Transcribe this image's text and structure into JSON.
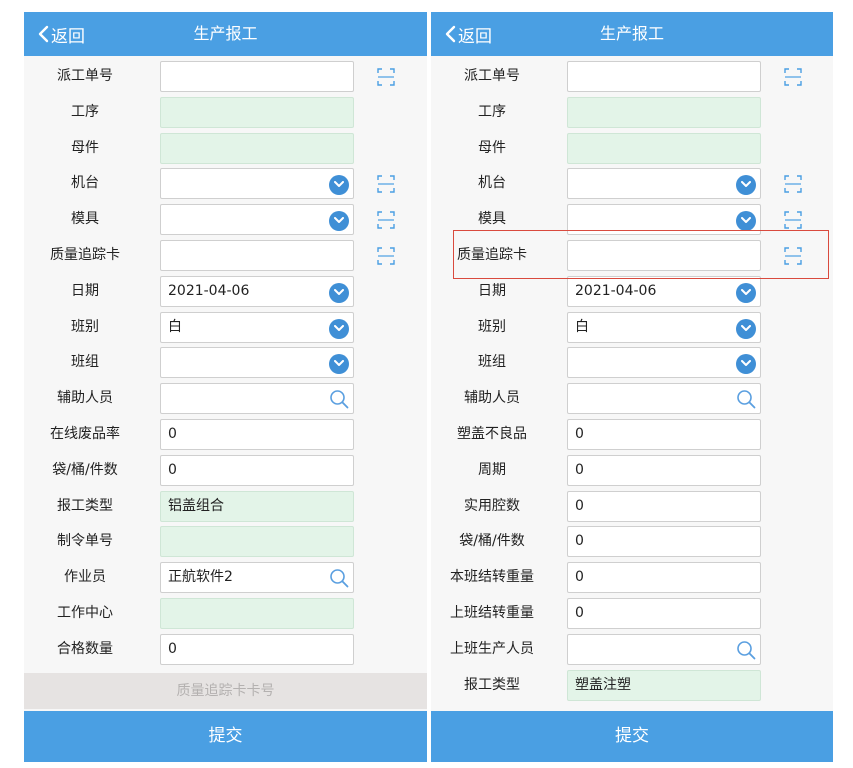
{
  "left": {
    "back_label": "返回",
    "title": "生产报工",
    "rows": [
      {
        "label": "派工单号",
        "value": "",
        "style": "input",
        "scan": true
      },
      {
        "label": "工序",
        "value": "",
        "style": "readonly"
      },
      {
        "label": "母件",
        "value": "",
        "style": "readonly"
      },
      {
        "label": "机台",
        "value": "",
        "style": "dropdown",
        "scan": true
      },
      {
        "label": "模具",
        "value": "",
        "style": "dropdown",
        "scan": true
      },
      {
        "label": "质量追踪卡",
        "value": "",
        "style": "input",
        "scan": true
      },
      {
        "label": "日期",
        "value": "2021-04-06",
        "style": "dropdown"
      },
      {
        "label": "班别",
        "value": "白",
        "style": "dropdown"
      },
      {
        "label": "班组",
        "value": "",
        "style": "dropdown"
      },
      {
        "label": "辅助人员",
        "value": "",
        "style": "search"
      },
      {
        "label": "在线废品率",
        "value": "0",
        "style": "input"
      },
      {
        "label": "袋/桶/件数",
        "value": "0",
        "style": "input"
      },
      {
        "label": "报工类型",
        "value": "铝盖组合",
        "style": "readonly"
      },
      {
        "label": "制令单号",
        "value": "",
        "style": "readonly"
      },
      {
        "label": "作业员",
        "value": "正航软件2",
        "style": "search"
      },
      {
        "label": "工作中心",
        "value": "",
        "style": "readonly"
      },
      {
        "label": "合格数量",
        "value": "0",
        "style": "input"
      }
    ],
    "gray_bar_label": "质量追踪卡卡号",
    "submit_label": "提交"
  },
  "right": {
    "back_label": "返回",
    "title": "生产报工",
    "rows": [
      {
        "label": "派工单号",
        "value": "",
        "style": "input",
        "scan": true
      },
      {
        "label": "工序",
        "value": "",
        "style": "readonly"
      },
      {
        "label": "母件",
        "value": "",
        "style": "readonly"
      },
      {
        "label": "机台",
        "value": "",
        "style": "dropdown",
        "scan": true
      },
      {
        "label": "模具",
        "value": "",
        "style": "dropdown",
        "scan": true
      },
      {
        "label": "质量追踪卡",
        "value": "",
        "style": "input",
        "scan": true
      },
      {
        "label": "日期",
        "value": "2021-04-06",
        "style": "dropdown"
      },
      {
        "label": "班别",
        "value": "白",
        "style": "dropdown"
      },
      {
        "label": "班组",
        "value": "",
        "style": "dropdown"
      },
      {
        "label": "辅助人员",
        "value": "",
        "style": "search"
      },
      {
        "label": "塑盖不良品",
        "value": "0",
        "style": "input"
      },
      {
        "label": "周期",
        "value": "0",
        "style": "input"
      },
      {
        "label": "实用腔数",
        "value": "0",
        "style": "input"
      },
      {
        "label": "袋/桶/件数",
        "value": "0",
        "style": "input"
      },
      {
        "label": "本班结转重量",
        "value": "0",
        "style": "input"
      },
      {
        "label": "上班结转重量",
        "value": "0",
        "style": "input"
      },
      {
        "label": "上班生产人员",
        "value": "",
        "style": "search"
      },
      {
        "label": "报工类型",
        "value": "塑盖注塑",
        "style": "readonly"
      }
    ],
    "submit_label": "提交"
  },
  "colors": {
    "header": "#4a9fe3",
    "readonly_field": "#e3f4e8",
    "dropdown_circle": "#3f8fd6",
    "highlight": "#d94a3e",
    "gray_bar": "#e6e3e2"
  },
  "icons": {
    "back": "chevron-left-icon",
    "dropdown": "chevron-down-icon",
    "search": "search-icon",
    "scan": "scan-icon"
  }
}
